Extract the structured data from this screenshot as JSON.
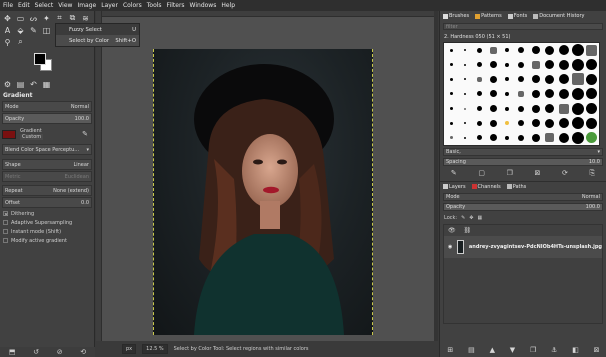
{
  "menu": [
    "File",
    "Edit",
    "Select",
    "View",
    "Image",
    "Layer",
    "Colors",
    "Tools",
    "Filters",
    "Windows",
    "Help"
  ],
  "popup": {
    "items": [
      {
        "label": "Fuzzy Select",
        "shortcut": "U"
      },
      {
        "label": "Select by Color",
        "shortcut": "Shift+O"
      }
    ]
  },
  "tool_options": {
    "title": "Gradient",
    "mode_label": "Mode",
    "mode_value": "Normal",
    "opacity_label": "Opacity",
    "opacity_value": "100.0",
    "gradient_label": "Gradient",
    "gradient_value": "Custom",
    "blend_space": "Blend Color Space Perceptu...",
    "shape_label": "Shape",
    "shape_value": "Linear",
    "metric_label": "Metric",
    "metric_value": "Euclidean",
    "repeat_label": "Repeat",
    "repeat_value": "None (extend)",
    "offset_label": "Offset",
    "offset_value": "0.0",
    "checks": [
      "Dithering",
      "Adaptive Supersampling",
      "Instant mode  (Shift)",
      "Modify active gradient"
    ]
  },
  "statusbar": {
    "unit": "px",
    "zoom": "12.5 %",
    "message": "Select by Color Tool: Select regions with similar colors"
  },
  "brushes": {
    "tabs": [
      "Brushes",
      "Patterns",
      "Fonts",
      "Document History"
    ],
    "filter_placeholder": "filter",
    "selected": "2. Hardness 050 (51 × 51)",
    "tag": "Basic,",
    "spacing_label": "Spacing",
    "spacing_value": "10.0"
  },
  "layers": {
    "tabs": [
      "Layers",
      "Channels",
      "Paths"
    ],
    "mode_label": "Mode",
    "mode_value": "Normal",
    "opacity_label": "Opacity",
    "opacity_value": "100.0",
    "lock_label": "Lock:",
    "layer_name": "andrey-zvyagintsev-PdcNIOb4HTs-unsplash.jpg"
  },
  "colors": {
    "brush_bg": "#fafafa",
    "foreground": "#000000",
    "background": "#ffffff",
    "gradient_swatch": "#7a1010"
  }
}
